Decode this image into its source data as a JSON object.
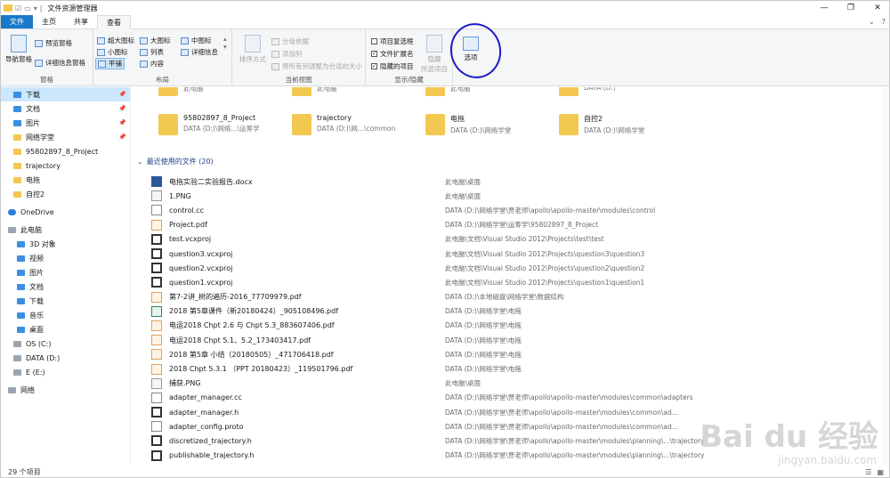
{
  "window": {
    "title": "文件资源管理器"
  },
  "tabs": {
    "file": "文件",
    "home": "主页",
    "share": "共享",
    "view": "查看"
  },
  "ribbon": {
    "panes": {
      "nav": "导航窗格",
      "preview": "预览窗格",
      "details": "详细信息窗格",
      "label": "窗格"
    },
    "layout": {
      "xl": "超大图标",
      "large": "大图标",
      "medium": "中图标",
      "small": "小图标",
      "list": "列表",
      "details": "详细信息",
      "tiles": "平铺",
      "content": "内容",
      "label": "布局"
    },
    "current": {
      "sort": "排序方式",
      "group": "分组依据",
      "addcol": "添加列",
      "fit": "将所有列调整为合适的大小",
      "label": "当前视图"
    },
    "showhide": {
      "checkboxes": "项目复选框",
      "ext": "文件扩展名",
      "hidden": "隐藏的项目",
      "hide": "隐藏",
      "hide2": "所选项目",
      "label": "显示/隐藏"
    },
    "options": {
      "label": "选项"
    }
  },
  "nav": [
    {
      "label": "下载",
      "pinned": true,
      "icon": "download-icon"
    },
    {
      "label": "文档",
      "pinned": true,
      "icon": "document-icon"
    },
    {
      "label": "图片",
      "pinned": true,
      "icon": "picture-icon"
    },
    {
      "label": "网络学堂",
      "pinned": true,
      "icon": "folder-icon"
    },
    {
      "label": "95802897_8_Project",
      "pinned": false,
      "icon": "folder-icon"
    },
    {
      "label": "trajectory",
      "pinned": false,
      "icon": "folder-icon"
    },
    {
      "label": "电拖",
      "pinned": false,
      "icon": "folder-icon"
    },
    {
      "label": "自控2",
      "pinned": false,
      "icon": "folder-icon"
    },
    {
      "label": "OneDrive",
      "pinned": false,
      "icon": "cloud-icon"
    },
    {
      "label": "此电脑",
      "pinned": false,
      "icon": "computer-icon"
    },
    {
      "label": "3D 对象",
      "pinned": false,
      "icon": "3d-icon"
    },
    {
      "label": "视频",
      "pinned": false,
      "icon": "video-icon"
    },
    {
      "label": "图片",
      "pinned": false,
      "icon": "picture-icon"
    },
    {
      "label": "文档",
      "pinned": false,
      "icon": "document-icon"
    },
    {
      "label": "下载",
      "pinned": false,
      "icon": "download-icon"
    },
    {
      "label": "音乐",
      "pinned": false,
      "icon": "music-icon"
    },
    {
      "label": "桌面",
      "pinned": false,
      "icon": "desktop-icon"
    },
    {
      "label": "OS (C:)",
      "pinned": false,
      "icon": "drive-icon"
    },
    {
      "label": "DATA (D:)",
      "pinned": false,
      "icon": "drive-icon"
    },
    {
      "label": "E (E:)",
      "pinned": false,
      "icon": "drive-icon"
    },
    {
      "label": "网络",
      "pinned": false,
      "icon": "network-icon"
    }
  ],
  "quick_top": [
    {
      "sub": "此电脑"
    },
    {
      "sub": "此电脑"
    },
    {
      "sub": "此电脑"
    },
    {
      "sub": "DATA (D:)"
    }
  ],
  "quick": [
    {
      "name": "95802897_8_Project",
      "sub": "DATA (D:)\\网络...\\运筹学"
    },
    {
      "name": "trajectory",
      "sub": "DATA (D:)\\网...\\common"
    },
    {
      "name": "电拖",
      "sub": "DATA (D:)\\网络学堂"
    },
    {
      "name": "自控2",
      "sub": "DATA (D:)\\网络学堂"
    }
  ],
  "recent": {
    "header": "最近使用的文件 (20)"
  },
  "files": [
    {
      "name": "电拖实验二实验报告.docx",
      "path": "此电脑\\桌面",
      "type": "doc"
    },
    {
      "name": "1.PNG",
      "path": "此电脑\\桌面",
      "type": "png"
    },
    {
      "name": "control.cc",
      "path": "DATA (D:)\\网络学堂\\贾老师\\apollo\\apollo-master\\modules\\control",
      "type": "txt"
    },
    {
      "name": "Project.pdf",
      "path": "DATA (D:)\\网络学堂\\运筹学\\95802897_8_Project",
      "type": "pdf"
    },
    {
      "name": "test.vcxproj",
      "path": "此电脑\\文档\\Visual Studio 2012\\Projects\\test\\test",
      "type": "vc"
    },
    {
      "name": "question3.vcxproj",
      "path": "此电脑\\文档\\Visual Studio 2012\\Projects\\question3\\question3",
      "type": "vc"
    },
    {
      "name": "question2.vcxproj",
      "path": "此电脑\\文档\\Visual Studio 2012\\Projects\\question2\\question2",
      "type": "vc"
    },
    {
      "name": "question1.vcxproj",
      "path": "此电脑\\文档\\Visual Studio 2012\\Projects\\question1\\question1",
      "type": "vc"
    },
    {
      "name": "第7-2讲_树的遍历-2016_77709979.pdf",
      "path": "DATA (D:)\\本地磁盘\\网络学堂\\数据结构",
      "type": "pdf"
    },
    {
      "name": "2018 第5章课件（新20180424）_905108496.pdf",
      "path": "DATA (D:)\\网络学堂\\电拖",
      "type": "ppt"
    },
    {
      "name": "电运2018 Chpt 2.6 与 Chpt 5.3_883607406.pdf",
      "path": "DATA (D:)\\网络学堂\\电拖",
      "type": "pdf"
    },
    {
      "name": "电运2018 Chpt 5.1、5.2_173403417.pdf",
      "path": "DATA (D:)\\网络学堂\\电拖",
      "type": "pdf"
    },
    {
      "name": "2018 第5章 小结（20180505）_471706418.pdf",
      "path": "DATA (D:)\\网络学堂\\电拖",
      "type": "pdf"
    },
    {
      "name": "2018 Chpt 5.3.1 （PPT 20180423）_119501796.pdf",
      "path": "DATA (D:)\\网络学堂\\电拖",
      "type": "pdf"
    },
    {
      "name": "捕获.PNG",
      "path": "此电脑\\桌面",
      "type": "png"
    },
    {
      "name": "adapter_manager.cc",
      "path": "DATA (D:)\\网络学堂\\贾老师\\apollo\\apollo-master\\modules\\common\\adapters",
      "type": "txt"
    },
    {
      "name": "adapter_manager.h",
      "path": "DATA (D:)\\网络学堂\\贾老师\\apollo\\apollo-master\\modules\\common\\ad...",
      "type": "vc"
    },
    {
      "name": "adapter_config.proto",
      "path": "DATA (D:)\\网络学堂\\贾老师\\apollo\\apollo-master\\modules\\common\\ad...",
      "type": "txt"
    },
    {
      "name": "discretized_trajectory.h",
      "path": "DATA (D:)\\网络学堂\\贾老师\\apollo\\apollo-master\\modules\\planning\\...\\trajectory",
      "type": "vc"
    },
    {
      "name": "publishable_trajectory.h",
      "path": "DATA (D:)\\网络学堂\\贾老师\\apollo\\apollo-master\\modules\\planning\\...\\trajectory",
      "type": "vc"
    }
  ],
  "status": {
    "count": "29 个项目"
  },
  "watermark": {
    "brand": "Bai du 经验",
    "url": "jingyan.baidu.com"
  }
}
